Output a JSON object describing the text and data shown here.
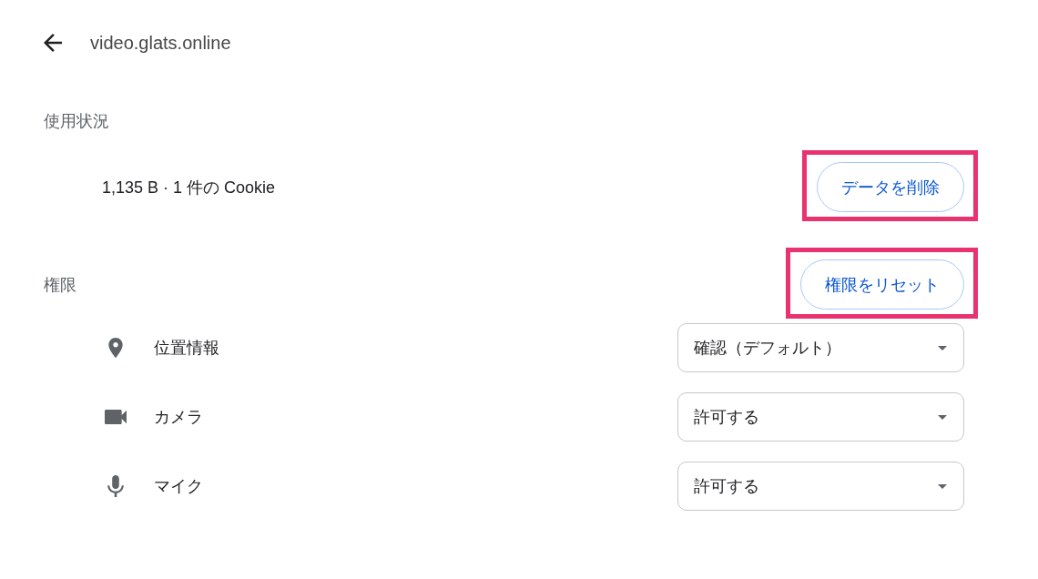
{
  "header": {
    "title": "video.glats.online"
  },
  "usage": {
    "heading": "使用状況",
    "summary": "1,135 B · 1 件の Cookie",
    "button": {
      "label": "データを削除",
      "highlighted": true
    }
  },
  "permissions": {
    "heading": "権限",
    "button": {
      "label": "権限をリセット",
      "highlighted": true
    },
    "items": [
      {
        "label": "位置情報",
        "value": "確認（デフォルト）"
      },
      {
        "label": "カメラ",
        "value": "許可する"
      },
      {
        "label": "マイク",
        "value": "許可する"
      }
    ]
  }
}
